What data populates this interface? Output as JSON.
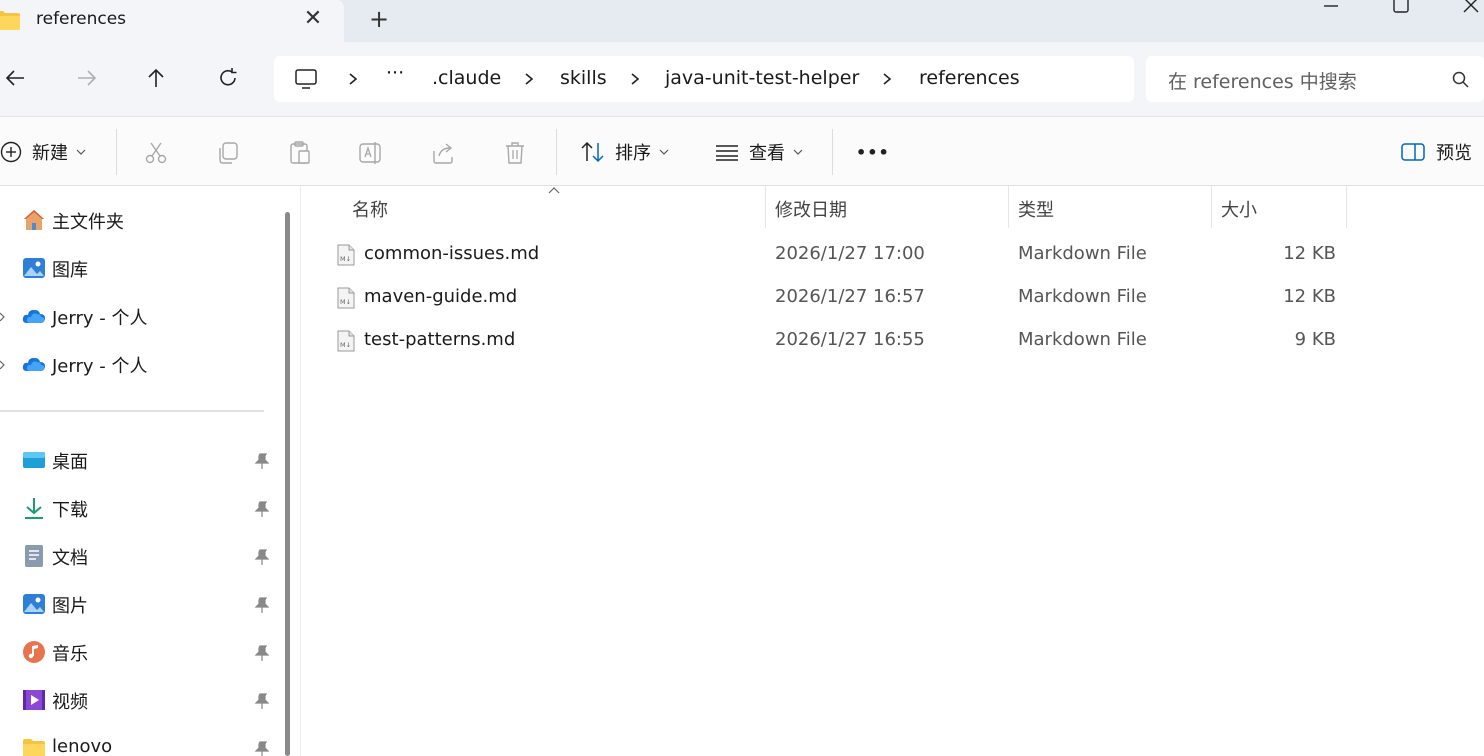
{
  "tab": {
    "title": "references"
  },
  "address": {
    "overflow": "···",
    "segments": [
      ".claude",
      "skills",
      "java-unit-test-helper",
      "references"
    ]
  },
  "search": {
    "placeholder": "在 references 中搜索"
  },
  "toolbar": {
    "new_label": "新建",
    "sort_label": "排序",
    "view_label": "查看",
    "more_label": "•••",
    "preview_label": "预览"
  },
  "sidebar": {
    "items": [
      {
        "label": "主文件夹",
        "icon": "home-icon"
      },
      {
        "label": "图库",
        "icon": "gallery-icon"
      },
      {
        "label": "Jerry - 个人",
        "icon": "onedrive-icon"
      },
      {
        "label": "Jerry - 个人",
        "icon": "onedrive-icon"
      },
      {
        "label": "桌面",
        "icon": "desktop-icon",
        "pinned": true
      },
      {
        "label": "下载",
        "icon": "download-icon",
        "pinned": true
      },
      {
        "label": "文档",
        "icon": "documents-icon",
        "pinned": true
      },
      {
        "label": "图片",
        "icon": "pictures-icon",
        "pinned": true
      },
      {
        "label": "音乐",
        "icon": "music-icon",
        "pinned": true
      },
      {
        "label": "视频",
        "icon": "videos-icon",
        "pinned": true
      },
      {
        "label": "lenovo",
        "icon": "folder-icon",
        "pinned": true
      }
    ]
  },
  "columns": {
    "name": "名称",
    "date": "修改日期",
    "type": "类型",
    "size": "大小"
  },
  "files": [
    {
      "name": "common-issues.md",
      "date": "2026/1/27 17:00",
      "type": "Markdown File",
      "size": "12 KB"
    },
    {
      "name": "maven-guide.md",
      "date": "2026/1/27 16:57",
      "type": "Markdown File",
      "size": "12 KB"
    },
    {
      "name": "test-patterns.md",
      "date": "2026/1/27 16:55",
      "type": "Markdown File",
      "size": "9 KB"
    }
  ],
  "colors": {
    "tabbar": "#e6eaf1",
    "navbar": "#f3f5f9",
    "accent": "#0067c0",
    "folder": "#f5c542"
  }
}
